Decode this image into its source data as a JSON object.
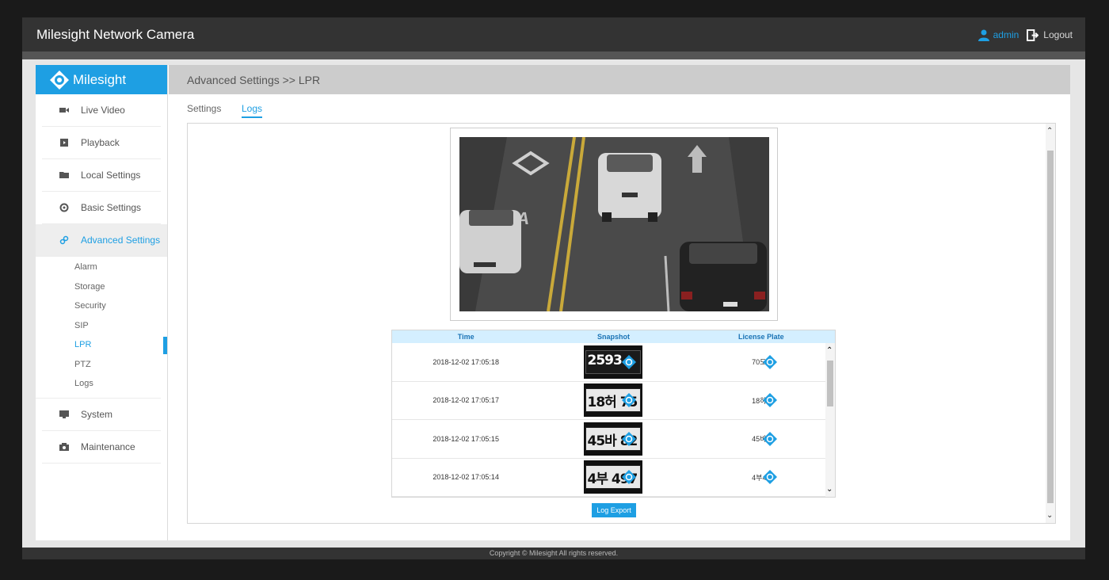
{
  "app": {
    "title": "Milesight Network Camera",
    "user": "admin",
    "logout": "Logout",
    "brand": "Milesight",
    "accent": "#1e9fe3"
  },
  "sidebar": {
    "items": [
      {
        "label": "Live Video",
        "icon": "video-camera-icon"
      },
      {
        "label": "Playback",
        "icon": "playback-icon"
      },
      {
        "label": "Local Settings",
        "icon": "folder-icon"
      },
      {
        "label": "Basic Settings",
        "icon": "gear-icon"
      },
      {
        "label": "Advanced Settings",
        "icon": "link-icon"
      },
      {
        "label": "System",
        "icon": "monitor-icon"
      },
      {
        "label": "Maintenance",
        "icon": "camera-icon"
      }
    ],
    "subitems": [
      "Alarm",
      "Storage",
      "Security",
      "SIP",
      "LPR",
      "PTZ",
      "Logs"
    ],
    "active_item": "Advanced Settings",
    "active_subitem": "LPR"
  },
  "header": {
    "breadcrumb": "Advanced Settings >> LPR"
  },
  "tabs": {
    "settings": "Settings",
    "logs": "Logs",
    "active": "Logs"
  },
  "log_table": {
    "columns": [
      "Time",
      "Snapshot",
      "License Plate"
    ],
    "rows": [
      {
        "time": "2018-12-02 17:05:18",
        "snapshot_text": "2593",
        "plate": "70도2"
      },
      {
        "time": "2018-12-02 17:05:17",
        "snapshot_text": "18허 75",
        "plate": "18하7"
      },
      {
        "time": "2018-12-02 17:05:15",
        "snapshot_text": "45바 82",
        "plate": "45바8"
      },
      {
        "time": "2018-12-02 17:05:14",
        "snapshot_text": "4부 497",
        "plate": "4부49"
      }
    ]
  },
  "buttons": {
    "log_export": "Log Export"
  },
  "footer": {
    "copyright": "Copyright © Milesight All rights reserved."
  }
}
